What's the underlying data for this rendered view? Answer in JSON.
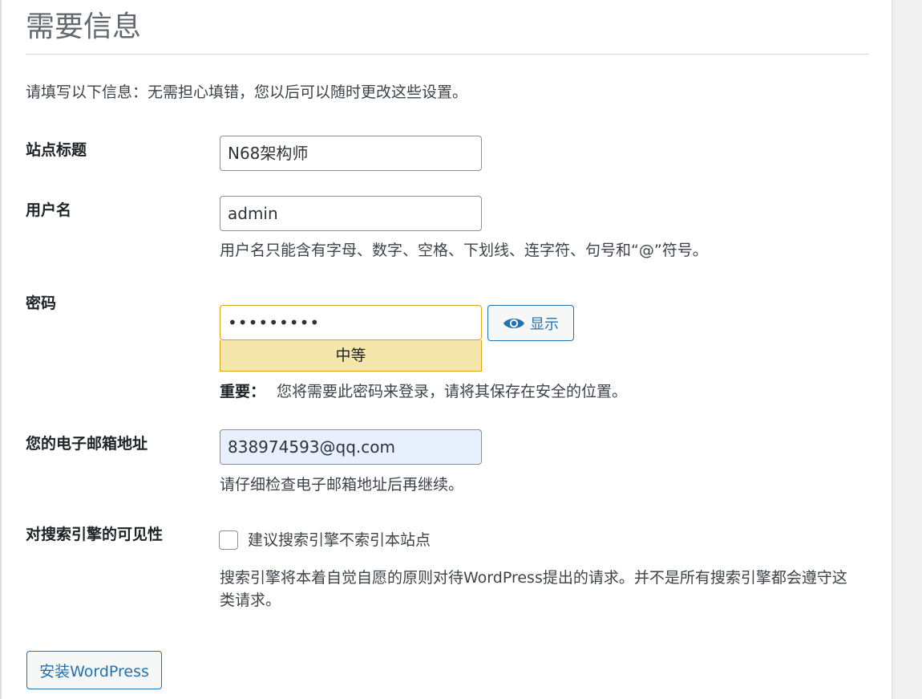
{
  "page": {
    "title": "需要信息",
    "intro": "请填写以下信息：无需担心填错，您以后可以随时更改这些设置。"
  },
  "site_title": {
    "label": "站点标题",
    "value": "N68架构师"
  },
  "username": {
    "label": "用户名",
    "value": "admin",
    "hint": "用户名只能含有字母、数字、空格、下划线、连字符、句号和“@”符号。"
  },
  "password": {
    "label": "密码",
    "value": "•••••••••",
    "show_button_label": "显示",
    "show_icon": "eye-icon",
    "strength": "中等",
    "strength_color": "#f5e6ab",
    "important_label": "重要：",
    "important_text": "您将需要此密码来登录，请将其保存在安全的位置。"
  },
  "email": {
    "label": "您的电子邮箱地址",
    "value": "838974593@qq.com",
    "hint": "请仔细检查电子邮箱地址后再继续。"
  },
  "search_visibility": {
    "label": "对搜索引擎的可见性",
    "checkbox_label": "建议搜索引擎不索引本站点",
    "checked": false,
    "hint": "搜索引擎将本着自觉自愿的原则对待WordPress提出的请求。并不是所有搜索引擎都会遵守这类请求。"
  },
  "install_button_label": "安装WordPress",
  "colors": {
    "accent": "#2271b1",
    "autofill_bg": "#e8f0fe",
    "warning_border": "#dba617"
  }
}
